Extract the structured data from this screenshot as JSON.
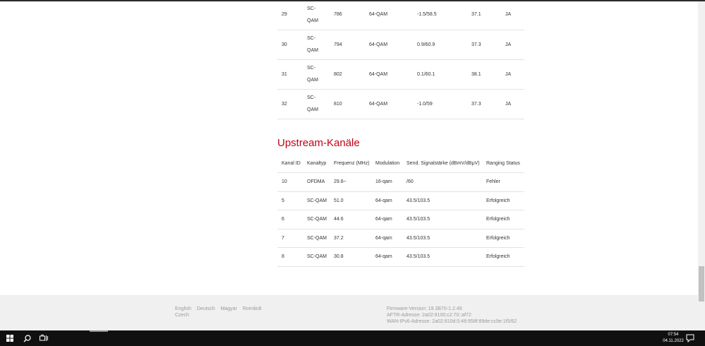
{
  "downstream": {
    "rows": [
      {
        "id": "29",
        "type_line1": "SC-",
        "type_line2": "QAM",
        "freq": "786",
        "mod": "64-QAM",
        "power": "-1.5/58.5",
        "snr": "37.1",
        "locked": "JA"
      },
      {
        "id": "30",
        "type_line1": "SC-",
        "type_line2": "QAM",
        "freq": "794",
        "mod": "64-QAM",
        "power": "0.9/60.9",
        "snr": "37.3",
        "locked": "JA"
      },
      {
        "id": "31",
        "type_line1": "SC-",
        "type_line2": "QAM",
        "freq": "802",
        "mod": "64-QAM",
        "power": "0.1/60.1",
        "snr": "38.1",
        "locked": "JA"
      },
      {
        "id": "32",
        "type_line1": "SC-",
        "type_line2": "QAM",
        "freq": "810",
        "mod": "64-QAM",
        "power": "-1.0/59",
        "snr": "37.3",
        "locked": "JA"
      }
    ]
  },
  "upstream": {
    "title": "Upstream-Kanäle",
    "headers": [
      "Kanal ID",
      "Kanaltyp",
      "Frequenz (MHz)",
      "Modulation",
      "Send. Signalstärke (dBmV/dBμV)",
      "Ranging Status"
    ],
    "rows": [
      {
        "id": "10",
        "type": "OFDMA",
        "freq": "29.8~",
        "mod": "16-qam",
        "power": "/60",
        "status": "Fehler"
      },
      {
        "id": "5",
        "type": "SC-QAM",
        "freq": "51.0",
        "mod": "64-qam",
        "power": "43.5/103.5",
        "status": "Erfolgreich"
      },
      {
        "id": "6",
        "type": "SC-QAM",
        "freq": "44.6",
        "mod": "64-qam",
        "power": "43.5/103.5",
        "status": "Erfolgreich"
      },
      {
        "id": "7",
        "type": "SC-QAM",
        "freq": "37.2",
        "mod": "64-qam",
        "power": "43.5/103.5",
        "status": "Erfolgreich"
      },
      {
        "id": "8",
        "type": "SC-QAM",
        "freq": "30.8",
        "mod": "64-qam",
        "power": "43.5/103.5",
        "status": "Erfolgreich"
      }
    ]
  },
  "footer": {
    "languages": [
      "English",
      "Deutsch",
      "Magyar",
      "Română",
      "Czech"
    ],
    "firmware": "Firmware-Version: 19.3B70-1.2.49",
    "aftr": "AFTR-Adresse: 2a02:8100:c2:70::af72",
    "wan_ipv6": "WAN-IPv6-Adresse: 2a02:810d:0:48:958f:89de:cc9e:1f5/62"
  },
  "taskbar": {
    "time": "07:54",
    "date": "04.11.2022",
    "icons": [
      "windows-start-icon",
      "search-icon",
      "task-view-icon",
      "notification-icon"
    ]
  },
  "colors": {
    "accent": "#c30014",
    "taskbar": "#101010",
    "footer_bg": "#f0f0f0"
  }
}
